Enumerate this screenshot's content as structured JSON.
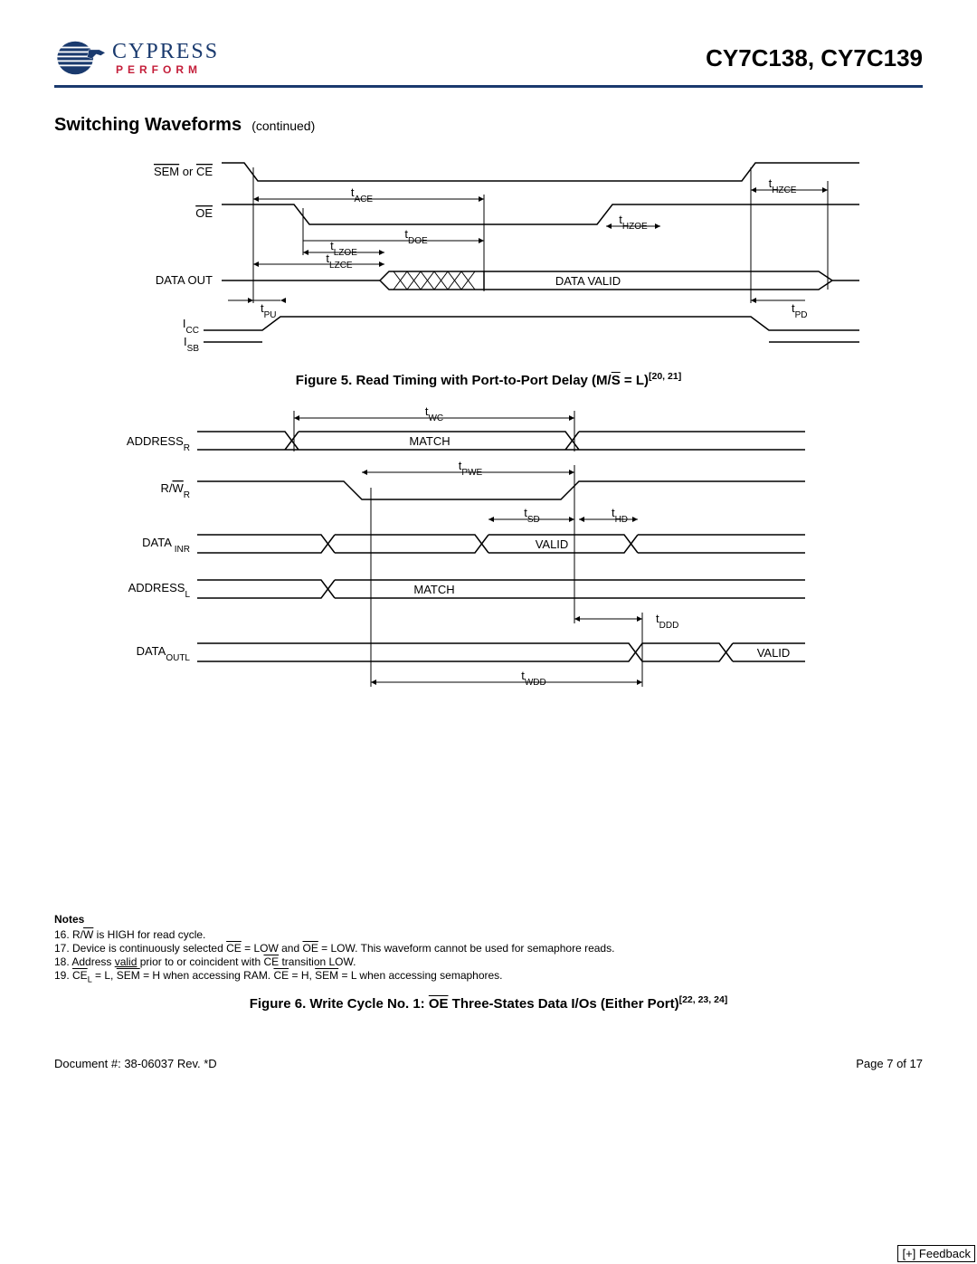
{
  "header": {
    "brand": "CYPRESS",
    "tagline": "PERFORM",
    "part_number": "CY7C138, CY7C139"
  },
  "section": {
    "title": "Switching Waveforms",
    "continued": "(continued)"
  },
  "fig5": {
    "caption_prefix": "Figure 5.  Read Timing with Port-to-Port Delay (M/",
    "caption_sbar": "S",
    "caption_suffix": " = L)",
    "caption_refs": "[20, 21]",
    "labels": {
      "sem_ce": "SEM or CE",
      "oe": "OE",
      "data_out": "DATA OUT",
      "icc": "I",
      "icc_sub": "CC",
      "isb": "I",
      "isb_sub": "SB",
      "data_valid": "DATA VALID"
    },
    "timings": {
      "tace": "ACE",
      "thzce": "HZCE",
      "tdoe": "DOE",
      "thzoe": "HZOE",
      "tlzoe": "LZOE",
      "tlzce": "LZCE",
      "tpu": "PU",
      "tpd": "PD"
    }
  },
  "fig6_top": {
    "labels": {
      "addressr": "ADDRESS",
      "addressr_sub": "R",
      "rwr_pre": "R/",
      "rwr_bar": "W",
      "rwr_sub": "R",
      "datainr": "DATA ",
      "datainr_sub": "INR",
      "addressl": "ADDRESS",
      "addressl_sub": "L",
      "dataoutl": "DATA",
      "dataoutl_sub": "OUTL",
      "match": "MATCH",
      "valid": "VALID"
    },
    "timings": {
      "twc": "WC",
      "tpwe": "PWE",
      "tsd": "SD",
      "thd": "HD",
      "tddd": "DDD",
      "twdd": "WDD"
    }
  },
  "notes": {
    "heading": "Notes",
    "n16_pre": "16. R/",
    "n16_bar": "W",
    "n16_post": " is HIGH for read cycle.",
    "n17_pre": "17. Device is continuously selected ",
    "n17_ce": "CE",
    "n17_mid1": " = LOW and ",
    "n17_oe": "OE",
    "n17_post": " = LOW. This waveform cannot be used for semaphore reads.",
    "n18_pre": "18. Address ",
    "n18_valid": "valid",
    "n18_mid": " prior to or coincident with ",
    "n18_ce": "CE",
    "n18_post": " transition LOW.",
    "n19_pre": "19. ",
    "n19_ce": "CE",
    "n19_lsub": "L",
    "n19_mid1": " = L, ",
    "n19_sem1": "SEM",
    "n19_mid2": " = H when accessing RAM. ",
    "n19_ce2": "CE",
    "n19_mid3": " = H, ",
    "n19_sem2": "SEM",
    "n19_post": " = L when accessing semaphores."
  },
  "fig6_caption": {
    "prefix": "Figure 6.  Write Cycle No. 1: ",
    "oe": "OE",
    "suffix": " Three-States Data I/Os (Either Port)",
    "refs": "[22, 23, 24]"
  },
  "footer": {
    "doc": "Document #: 38-06037  Rev. *D",
    "page": "Page 7 of 17"
  },
  "feedback": "[+] Feedback"
}
